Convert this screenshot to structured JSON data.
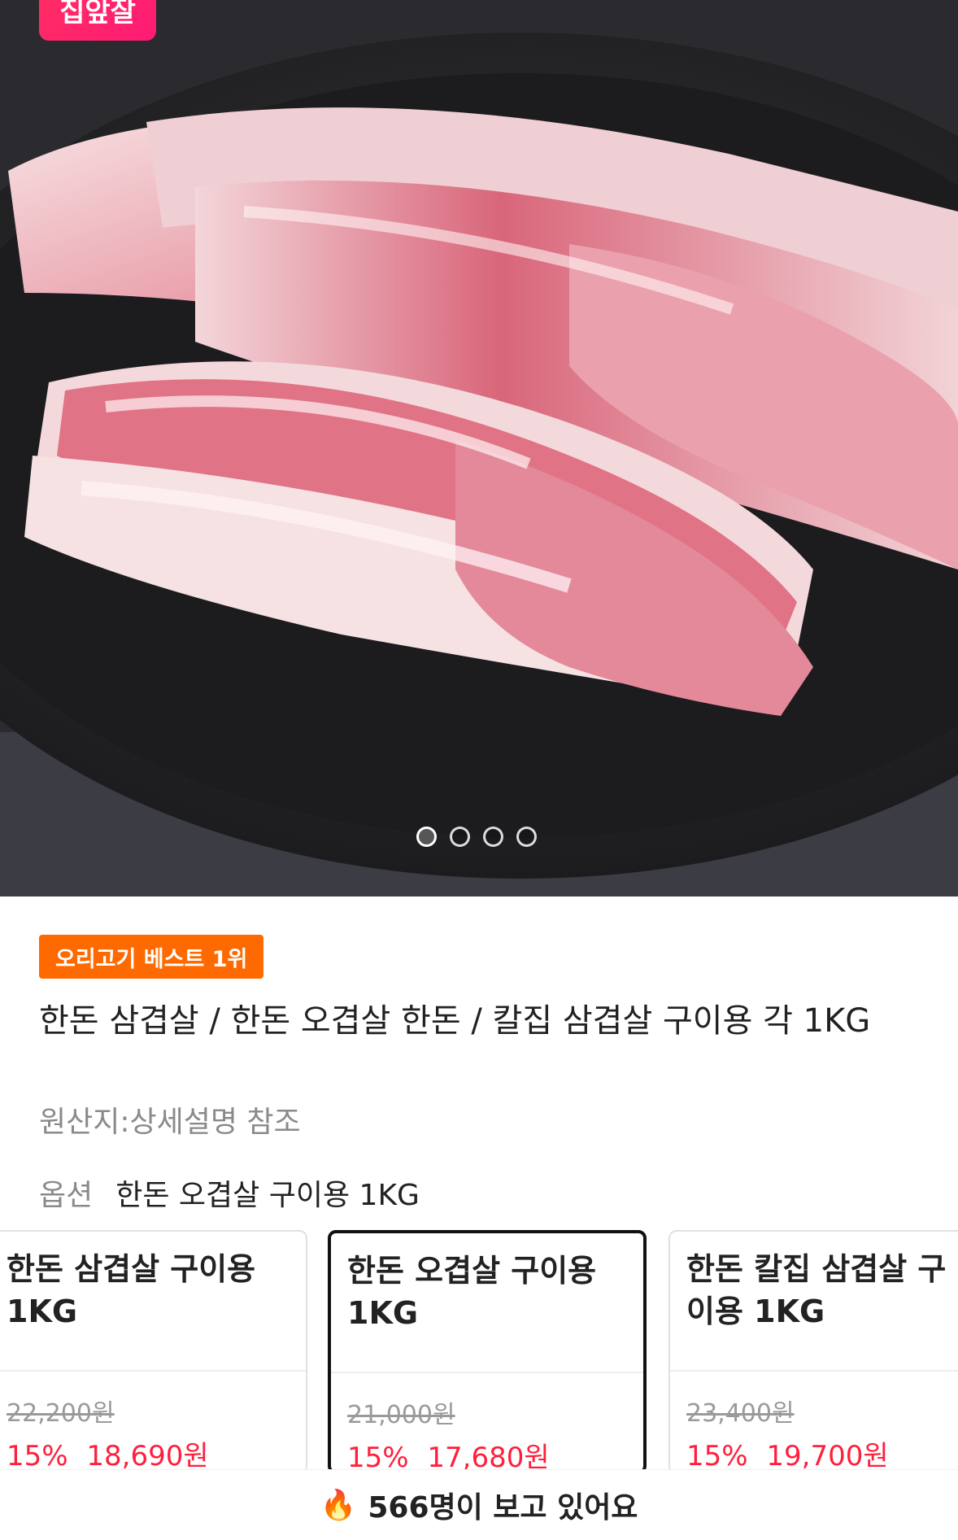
{
  "brand": {
    "badge_text": "집앞잘"
  },
  "gallery": {
    "current_page": 1,
    "total_pages": 4
  },
  "product": {
    "badge": "오리고기 베스트 1위",
    "title": "한돈 삼겹살 / 한돈 오겹살 한돈 / 칼집 삼겹살  구이용 각 1KG",
    "origin": "원산지:상세설명 참조",
    "option_label": "옵션",
    "option_value": "한돈 오겹살 구이용 1KG"
  },
  "options": [
    {
      "name": "한돈 삼겹살 구이용 1KG",
      "original_price": "22,200원",
      "discount": "15%",
      "sale_price": "18,690원",
      "selected": false
    },
    {
      "name": "한돈 오겹살 구이용 1KG",
      "original_price": "21,000원",
      "discount": "15%",
      "sale_price": "17,680원",
      "selected": true
    },
    {
      "name": "한돈 칼집 삼겹살 구이용 1KG",
      "original_price": "23,400원",
      "discount": "15%",
      "sale_price": "19,700원",
      "selected": false
    }
  ],
  "viewers": {
    "icon": "fire-icon",
    "text": "566명이 보고 있어요"
  },
  "colors": {
    "accent_red": "#ff1f3d",
    "badge_orange": "#ff6a00",
    "brand_pink": "#ff2e63"
  }
}
